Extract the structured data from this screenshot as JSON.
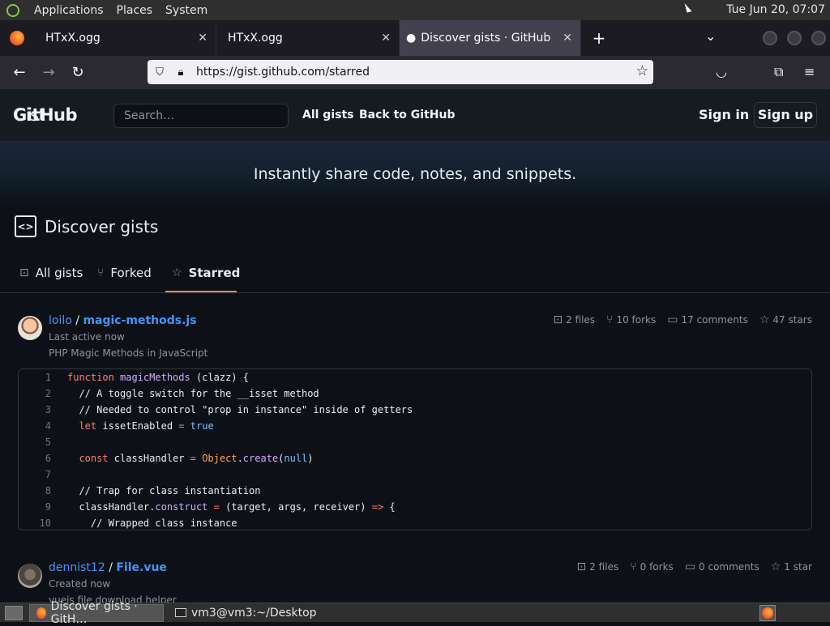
{
  "system_bar": {
    "menus": [
      "Applications",
      "Places",
      "System"
    ],
    "clock": "Tue Jun 20, 07:07"
  },
  "browser": {
    "tabs": [
      {
        "label": "HTxX.ogg"
      },
      {
        "label": "HTxX.ogg"
      },
      {
        "label": "Discover gists · GitHub"
      }
    ],
    "url": "https://gist.github.com/starred"
  },
  "github": {
    "logo_main": "GitHub",
    "logo_sub": "Gist",
    "search_placeholder": "Search…",
    "nav": [
      "All gists",
      "Back to GitHub"
    ],
    "sign_in": "Sign in",
    "sign_up": "Sign up",
    "hero": "Instantly share code, notes, and snippets.",
    "page_title": "Discover gists",
    "subnav": [
      "All gists",
      "Forked",
      "Starred"
    ]
  },
  "gists": [
    {
      "owner": "loilo",
      "file": "magic-methods.js",
      "active": "Last active now",
      "description": "PHP Magic Methods in JavaScript",
      "files": "2 files",
      "forks": "10 forks",
      "comments": "17 comments",
      "stars": "47 stars",
      "code": [
        {
          "n": "1",
          "t": "function magicMethods (clazz) {"
        },
        {
          "n": "2",
          "t": "  // A toggle switch for the __isset method"
        },
        {
          "n": "3",
          "t": "  // Needed to control \"prop in instance\" inside of getters"
        },
        {
          "n": "4",
          "t": "  let issetEnabled = true"
        },
        {
          "n": "5",
          "t": ""
        },
        {
          "n": "6",
          "t": "  const classHandler = Object.create(null)"
        },
        {
          "n": "7",
          "t": ""
        },
        {
          "n": "8",
          "t": "  // Trap for class instantiation"
        },
        {
          "n": "9",
          "t": "  classHandler.construct = (target, args, receiver) => {"
        },
        {
          "n": "10",
          "t": "    // Wrapped class instance"
        }
      ]
    },
    {
      "owner": "dennist12",
      "file": "File.vue",
      "active": "Created now",
      "description": "vuejs file download helper",
      "files": "2 files",
      "forks": "0 forks",
      "comments": "0 comments",
      "stars": "1 star"
    }
  ],
  "taskbar": {
    "items": [
      "Discover gists · GitH…",
      "vm3@vm3:~/Desktop"
    ]
  }
}
